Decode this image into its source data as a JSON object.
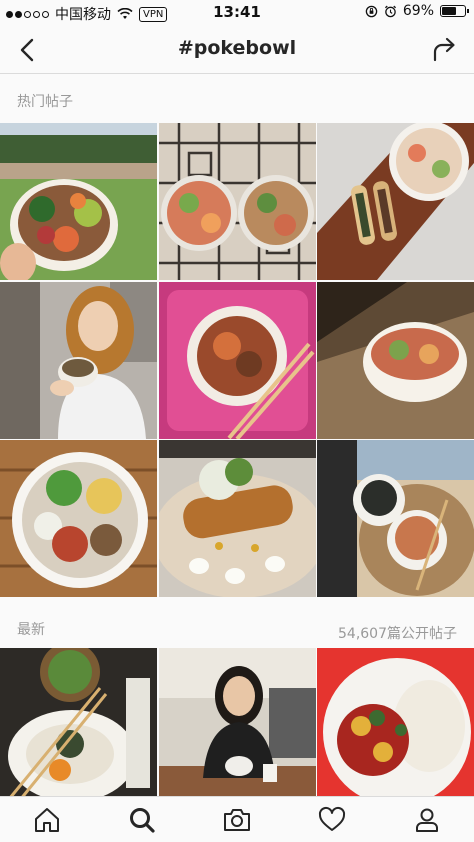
{
  "status_bar": {
    "carrier": "中国移动",
    "vpn": "VPN",
    "time": "13:41",
    "battery": "69%",
    "battery_level": 0.69
  },
  "header": {
    "title": "#pokebowl"
  },
  "top_posts": {
    "label": "热门帖子"
  },
  "recent": {
    "label": "最新",
    "count": "54,607篇公开帖子"
  },
  "tab_bar": {
    "items": [
      "home-icon",
      "search-icon",
      "camera-icon",
      "heart-icon",
      "profile-icon"
    ]
  }
}
